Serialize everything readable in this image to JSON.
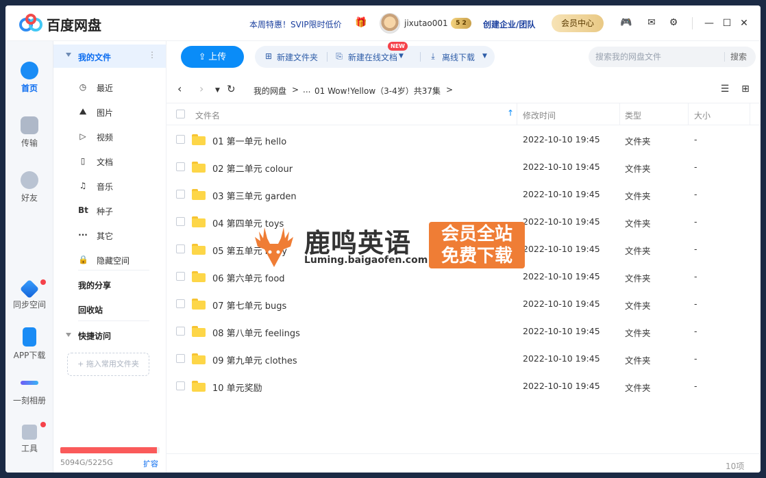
{
  "app": {
    "name": "百度网盘"
  },
  "header": {
    "promo": "本周特惠！SVIP限时低价",
    "username": "jixutao001",
    "vip_level": "5 2",
    "create_team": "创建企业/团队",
    "member_center": "会员中心"
  },
  "rail": {
    "items": [
      {
        "label": "首页"
      },
      {
        "label": "传输"
      },
      {
        "label": "好友"
      },
      {
        "label": "同步空间"
      },
      {
        "label": "APP下载"
      },
      {
        "label": "一刻相册"
      },
      {
        "label": "工具"
      }
    ]
  },
  "nav": {
    "my_files": "我的文件",
    "items": [
      {
        "icon": "◷",
        "label": "最近"
      },
      {
        "icon": "⛰",
        "label": "图片"
      },
      {
        "icon": "▷",
        "label": "视频"
      },
      {
        "icon": "▯",
        "label": "文档"
      },
      {
        "icon": "♫",
        "label": "音乐"
      },
      {
        "icon": "Bt",
        "label": "种子"
      },
      {
        "icon": "···",
        "label": "其它"
      },
      {
        "icon": "🔒",
        "label": "隐藏空间"
      }
    ],
    "my_share": "我的分享",
    "recycle": "回收站",
    "quick_access": "快捷访问",
    "drop_hint": "+ 拖入常用文件夹",
    "quota_used_fraction": 0.975,
    "quota_text": "5094G/5225G",
    "expand": "扩容"
  },
  "toolbar": {
    "upload": "上传",
    "new_folder": "新建文件夹",
    "new_doc": "新建在线文档",
    "new_badge": "NEW",
    "offline_download": "离线下载",
    "search_placeholder": "搜索我的网盘文件",
    "search_button": "搜索"
  },
  "breadcrumb": {
    "root": "我的网盘",
    "sep": ">",
    "ellipsis": "...",
    "current": "01 Wow!Yellow（3-4岁）共37集",
    "tail": ">"
  },
  "table": {
    "headers": {
      "name": "文件名",
      "time": "修改时间",
      "type": "类型",
      "size": "大小"
    },
    "rows": [
      {
        "name": "01 第一单元 hello",
        "time": "2022-10-10 19:45",
        "type": "文件夹",
        "size": "-"
      },
      {
        "name": "02 第二单元 colour",
        "time": "2022-10-10 19:45",
        "type": "文件夹",
        "size": "-"
      },
      {
        "name": "03 第三单元 garden",
        "time": "2022-10-10 19:45",
        "type": "文件夹",
        "size": "-"
      },
      {
        "name": "04 第四单元 toys",
        "time": "2022-10-10 19:45",
        "type": "文件夹",
        "size": "-"
      },
      {
        "name": "05 第五单元 body",
        "time": "2022-10-10 19:45",
        "type": "文件夹",
        "size": "-"
      },
      {
        "name": "06 第六单元 food",
        "time": "2022-10-10 19:45",
        "type": "文件夹",
        "size": "-"
      },
      {
        "name": "07 第七单元 bugs",
        "time": "2022-10-10 19:45",
        "type": "文件夹",
        "size": "-"
      },
      {
        "name": "08 第八单元 feelings",
        "time": "2022-10-10 19:45",
        "type": "文件夹",
        "size": "-"
      },
      {
        "name": "09 第九单元 clothes",
        "time": "2022-10-10 19:45",
        "type": "文件夹",
        "size": "-"
      },
      {
        "name": "10 单元奖励",
        "time": "2022-10-10 19:45",
        "type": "文件夹",
        "size": "-"
      }
    ],
    "count": "10项"
  },
  "watermark": {
    "title": "鹿鸣英语",
    "url": "Luming.baigaofen.com",
    "box_line1": "会员全站",
    "box_line2": "免费下载"
  },
  "colors": {
    "accent": "#0a8cf8",
    "watermark": "#ef7d35",
    "quota": "#fa5a5a",
    "folder": "#fdd648"
  }
}
